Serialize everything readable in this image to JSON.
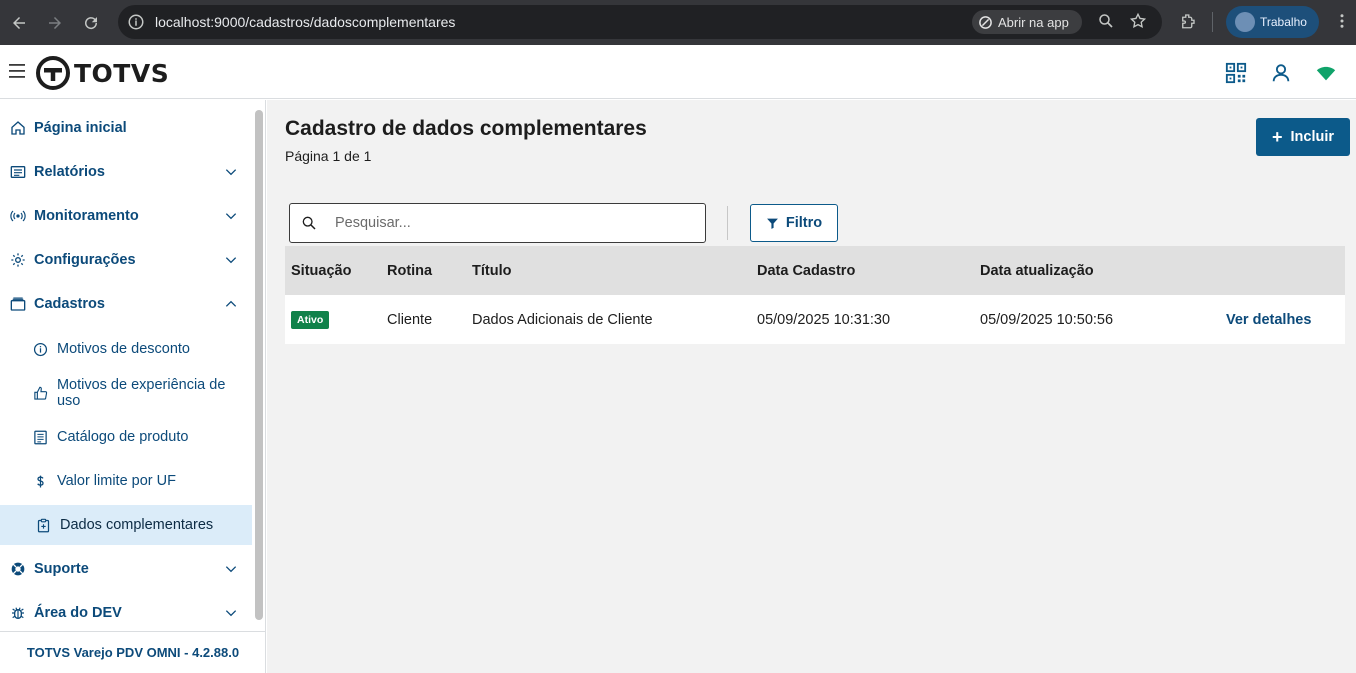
{
  "browser": {
    "url": "localhost:9000/cadastros/dadoscomplementares",
    "open_app_label": "Abrir na app",
    "profile_label": "Trabalho"
  },
  "header": {
    "logo_text": "TOTVS"
  },
  "sidebar": {
    "items": [
      {
        "label": "Página inicial",
        "icon": "home-icon",
        "expandable": false
      },
      {
        "label": "Relatórios",
        "icon": "report-icon",
        "expandable": true
      },
      {
        "label": "Monitoramento",
        "icon": "broadcast-icon",
        "expandable": true
      },
      {
        "label": "Configurações",
        "icon": "gear-icon",
        "expandable": true
      },
      {
        "label": "Cadastros",
        "icon": "folder-icon",
        "expandable": true,
        "expanded": true
      }
    ],
    "subitems": [
      {
        "label": "Motivos de desconto",
        "icon": "info-icon"
      },
      {
        "label": "Motivos de experiência de uso",
        "icon": "thumbs-up-icon"
      },
      {
        "label": "Catálogo de produto",
        "icon": "catalog-icon"
      },
      {
        "label": "Valor limite por UF",
        "icon": "dollar-icon"
      },
      {
        "label": "Dados complementares",
        "icon": "clipboard-icon",
        "active": true
      }
    ],
    "bottom_items": [
      {
        "label": "Suporte",
        "icon": "lifebuoy-icon"
      },
      {
        "label": "Área do DEV",
        "icon": "bug-icon"
      }
    ],
    "footer": "TOTVS Varejo PDV OMNI - 4.2.88.0"
  },
  "main": {
    "title": "Cadastro de dados complementares",
    "subtitle": "Página 1 de 1",
    "add_button": "Incluir",
    "search_placeholder": "Pesquisar...",
    "filter_button": "Filtro",
    "table": {
      "columns": [
        "Situação",
        "Rotina",
        "Título",
        "Data Cadastro",
        "Data atualização"
      ],
      "rows": [
        {
          "status": "Ativo",
          "rotina": "Cliente",
          "titulo": "Dados Adicionais de Cliente",
          "data_cadastro": "05/09/2025 10:31:30",
          "data_atualizacao": "05/09/2025 10:50:56",
          "action": "Ver detalhes"
        }
      ]
    }
  },
  "colors": {
    "primary": "#0c5a8a",
    "nav_text": "#0c4a7a",
    "active_bg": "#dbecf9",
    "badge_green": "#10824a",
    "content_bg": "#f2f2f2"
  }
}
